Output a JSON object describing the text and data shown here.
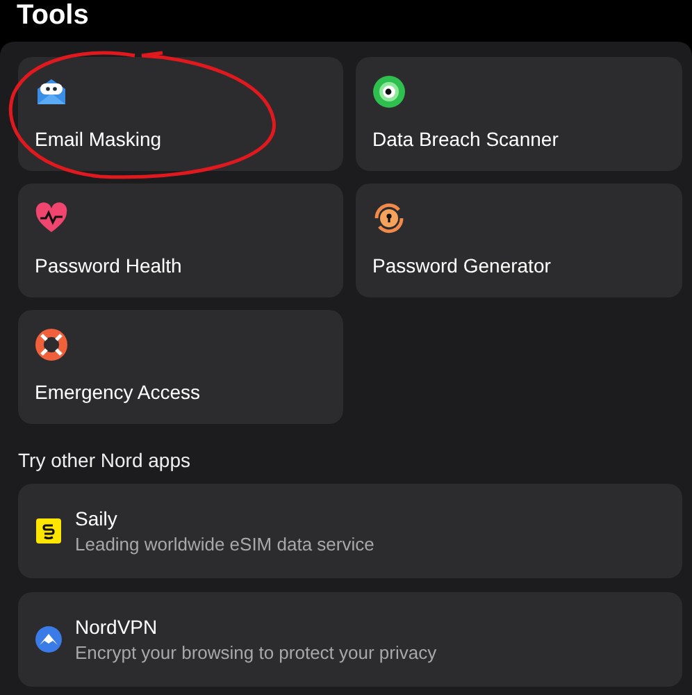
{
  "header": {
    "title": "Tools"
  },
  "tools": [
    {
      "label": "Email Masking",
      "kind": "mask"
    },
    {
      "label": "Data Breach Scanner",
      "kind": "scanner"
    },
    {
      "label": "Password Health",
      "kind": "heart"
    },
    {
      "label": "Password Generator",
      "kind": "generator"
    },
    {
      "label": "Emergency Access",
      "kind": "lifebuoy"
    }
  ],
  "other_apps": {
    "heading": "Try other Nord apps",
    "apps": [
      {
        "name": "Saily",
        "description": "Leading worldwide eSIM data service",
        "kind": "saily"
      },
      {
        "name": "NordVPN",
        "description": "Encrypt your browsing to protect your privacy",
        "kind": "vpn"
      }
    ]
  },
  "annotation": {
    "kind": "circle"
  }
}
